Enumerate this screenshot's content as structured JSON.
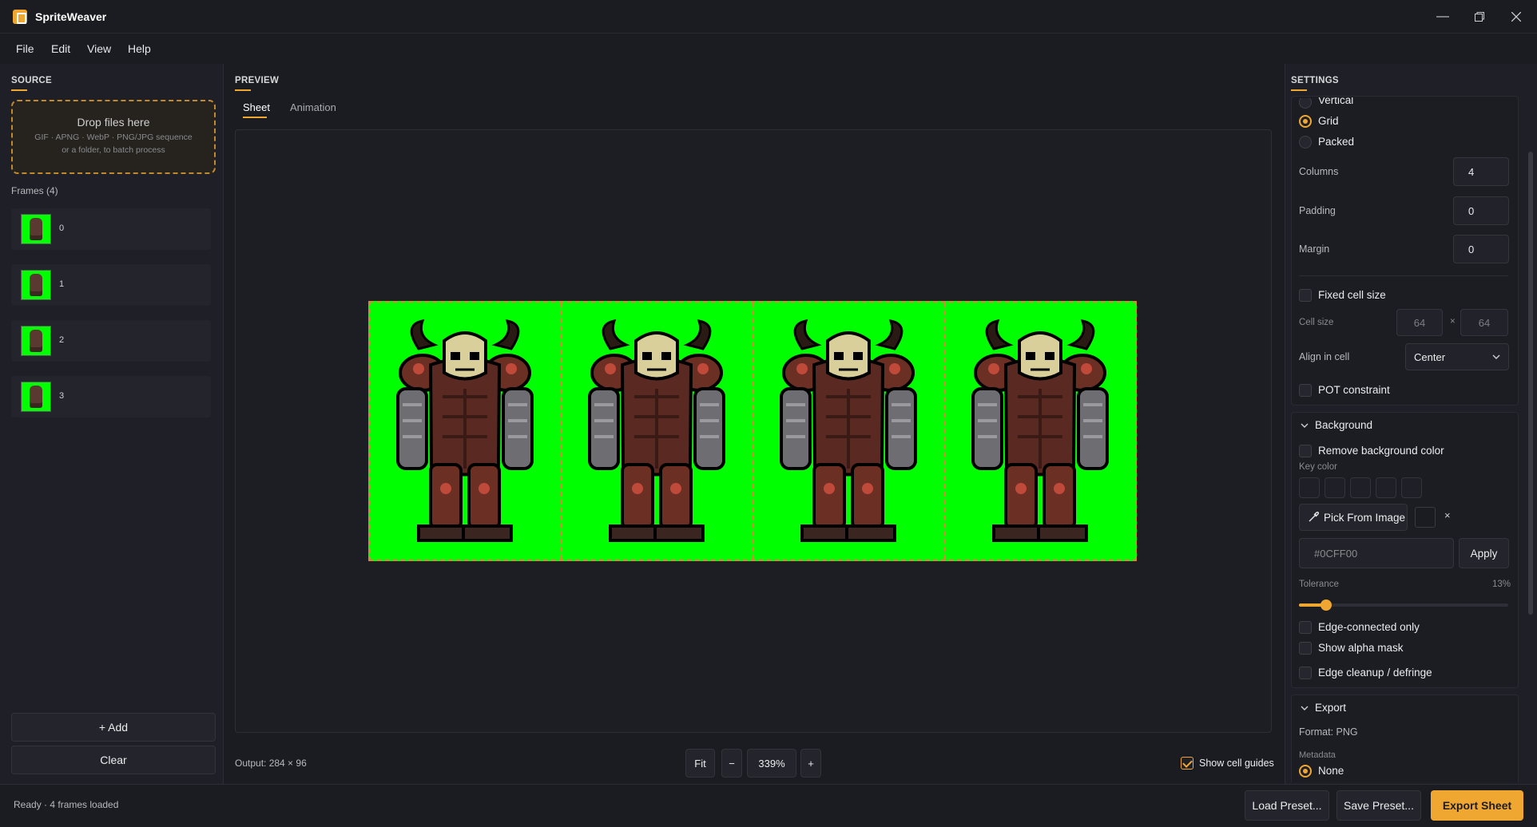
{
  "app": {
    "title": "SpriteWeaver",
    "accent": "#F0A732"
  },
  "menu": [
    "File",
    "Edit",
    "View",
    "Help"
  ],
  "source": {
    "title": "SOURCE",
    "dropzone": {
      "main": "Drop files here",
      "sub": "GIF · APNG · WebP · PNG/JPG sequence",
      "sub2": "or a folder, to batch process"
    },
    "frames_label": "Frames (4)",
    "frames": [
      "0",
      "1",
      "2",
      "3"
    ],
    "add_label": "+ Add",
    "clear_label": "Clear"
  },
  "preview": {
    "title": "PREVIEW",
    "tabs": [
      "Sheet",
      "Animation"
    ],
    "active_tab": "Sheet",
    "output": "Output: 284 × 96",
    "fit_label": "Fit",
    "zoom_out": "−",
    "zoom": "339%",
    "zoom_in": "+",
    "cell_guides_label": "Show cell guides",
    "cell_guides_checked": true,
    "sheet_bg": "#00FF00",
    "guide_color": "#E0803A"
  },
  "settings": {
    "title": "SETTINGS",
    "layout": {
      "options": [
        "Vertical",
        "Grid",
        "Packed"
      ],
      "selected": "Grid"
    },
    "columns_label": "Columns",
    "columns": "4",
    "padding_label": "Padding",
    "padding": "0",
    "margin_label": "Margin",
    "margin": "0",
    "fixed_cell_label": "Fixed cell size",
    "cell_size_label": "Cell size",
    "cell_w": "64",
    "cell_x": "×",
    "cell_h": "64",
    "align_label": "Align in cell",
    "align": "Center",
    "pot_label": "POT constraint",
    "background": {
      "title": "Background",
      "remove_label": "Remove background color",
      "key_color_label": "Key color",
      "pick_label": "Pick From Image",
      "clear_x": "×",
      "hex_placeholder": "#0CFF00",
      "apply_label": "Apply",
      "tolerance_label": "Tolerance",
      "tolerance": "13%",
      "tolerance_value": 0.13,
      "edge_connected_label": "Edge-connected only",
      "alpha_mask_label": "Show alpha mask",
      "defringe_label": "Edge cleanup / defringe"
    },
    "export": {
      "title": "Export",
      "format": "Format: PNG",
      "metadata_label": "Metadata",
      "metadata_selected": "None"
    }
  },
  "status": {
    "text": "Ready · 4 frames loaded",
    "load_preset": "Load Preset...",
    "save_preset": "Save Preset...",
    "export_sheet": "Export Sheet"
  }
}
